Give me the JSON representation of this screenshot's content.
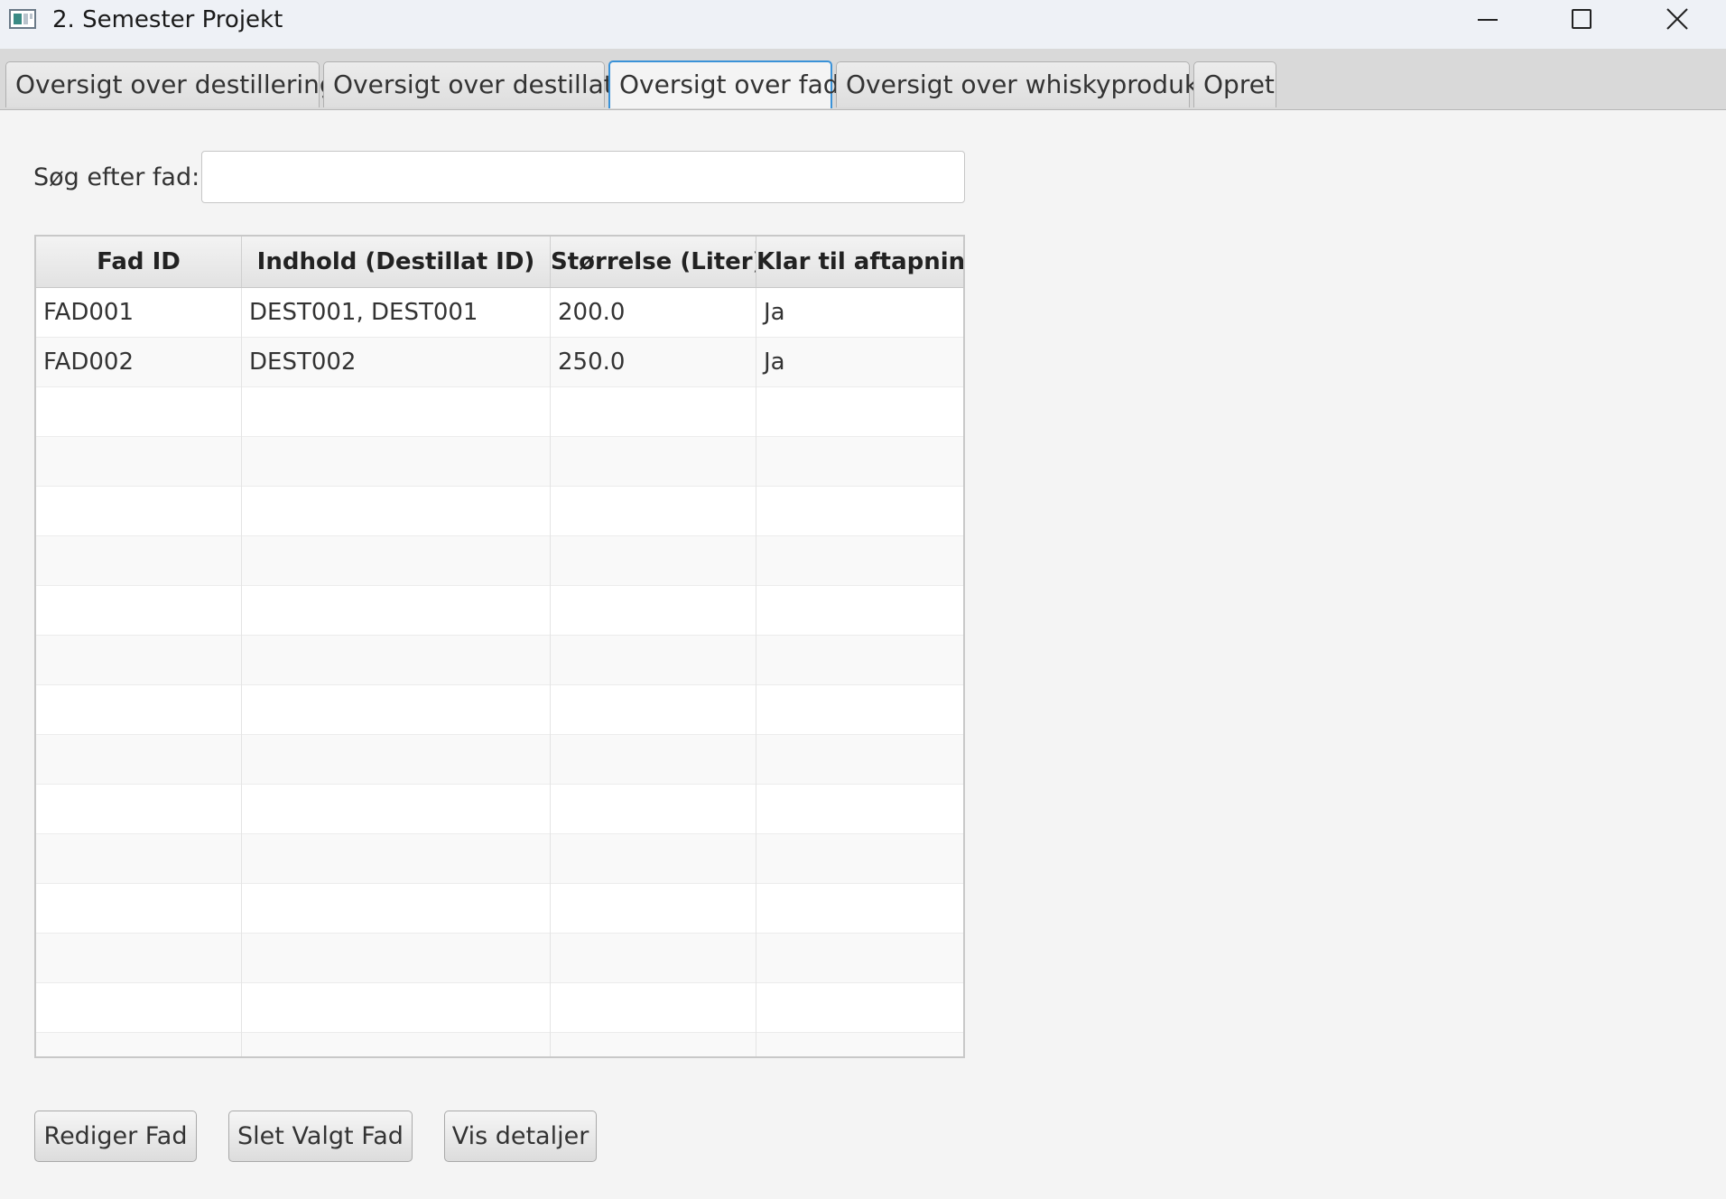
{
  "window": {
    "title": "2. Semester Projekt"
  },
  "tabs": [
    {
      "label": "Oversigt over destilleringer",
      "active": false
    },
    {
      "label": "Oversigt over destillater",
      "active": false
    },
    {
      "label": "Oversigt over fade",
      "active": true
    },
    {
      "label": "Oversigt over whiskyprodukter",
      "active": false
    },
    {
      "label": "Opret",
      "active": false
    }
  ],
  "search": {
    "label": "Søg efter fad:",
    "value": "",
    "placeholder": ""
  },
  "table": {
    "columns": [
      "Fad ID",
      "Indhold (Destillat ID)",
      "Størrelse (Liter)",
      "Klar til aftapning"
    ],
    "rows": [
      [
        "FAD001",
        "DEST001, DEST001",
        "200.0",
        "Ja"
      ],
      [
        "FAD002",
        "DEST002",
        "250.0",
        "Ja"
      ]
    ]
  },
  "buttons": {
    "edit": "Rediger Fad",
    "delete": "Slet Valgt Fad",
    "details": "Vis detaljer"
  },
  "colors": {
    "active_tab_border": "#3a92d8",
    "background": "#f4f4f4"
  }
}
